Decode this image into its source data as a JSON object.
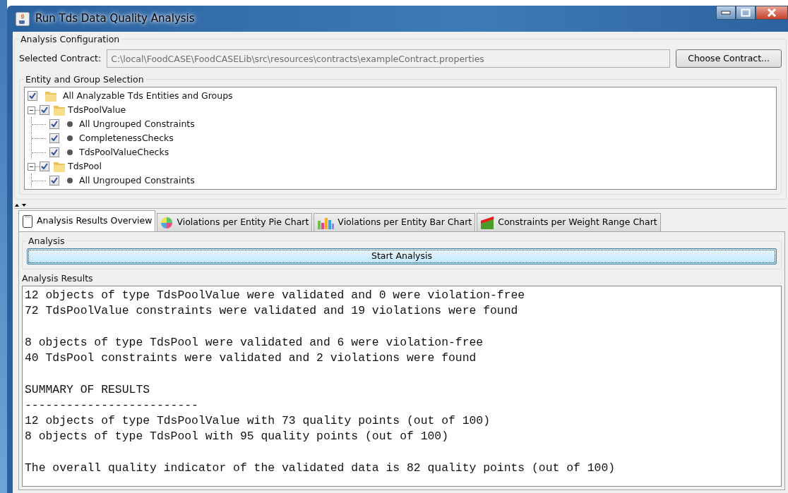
{
  "window": {
    "title": "Run Tds Data Quality Analysis"
  },
  "configuration": {
    "legend": "Analysis Configuration",
    "contract_label": "Selected Contract:",
    "contract_value": "C:\\local\\FoodCASE\\FoodCASELib\\src\\resources\\contracts\\exampleContract.properties",
    "choose_button": "Choose Contract..."
  },
  "selection": {
    "legend": "Entity and Group Selection",
    "tree": [
      {
        "label": "All Analyzable Tds Entities and Groups",
        "kind": "folder",
        "checked": true
      },
      {
        "label": "TdsPoolValue",
        "kind": "folder",
        "checked": true,
        "expanded": true,
        "children": [
          {
            "label": "All Ungrouped Constraints",
            "kind": "constraint",
            "checked": true
          },
          {
            "label": "CompletenessChecks",
            "kind": "constraint",
            "checked": true
          },
          {
            "label": "TdsPoolValueChecks",
            "kind": "constraint",
            "checked": true
          }
        ]
      },
      {
        "label": "TdsPool",
        "kind": "folder",
        "checked": true,
        "expanded": true,
        "children": [
          {
            "label": "All Ungrouped Constraints",
            "kind": "constraint",
            "checked": true
          }
        ]
      }
    ]
  },
  "tabs": [
    {
      "label": "Analysis Results Overview",
      "kind": "notepad",
      "selected": true
    },
    {
      "label": "Violations per Entity Pie Chart",
      "kind": "pie",
      "selected": false
    },
    {
      "label": "Violations per Entity Bar Chart",
      "kind": "bar",
      "selected": false
    },
    {
      "label": "Constraints per Weight Range Chart",
      "kind": "area",
      "selected": false
    }
  ],
  "analysis": {
    "legend": "Analysis",
    "start_button": "Start Analysis"
  },
  "results": {
    "label": "Analysis Results",
    "paragraphs": [
      [
        "12 objects of type TdsPoolValue were validated and 0 were violation-free",
        "72 TdsPoolValue constraints were validated and 19 violations were found"
      ],
      [
        "8 objects of type TdsPool were validated and 6 were violation-free",
        "40 TdsPool constraints were validated and 2 violations were found"
      ],
      [
        "SUMMARY OF RESULTS",
        "-------------------------",
        "12 objects of type TdsPoolValue with 73 quality points (out of 100)",
        "8 objects of type TdsPool with 95 quality points (out of 100)"
      ],
      [
        "The overall quality indicator of the validated data is 82 quality points (out of 100)"
      ]
    ]
  }
}
